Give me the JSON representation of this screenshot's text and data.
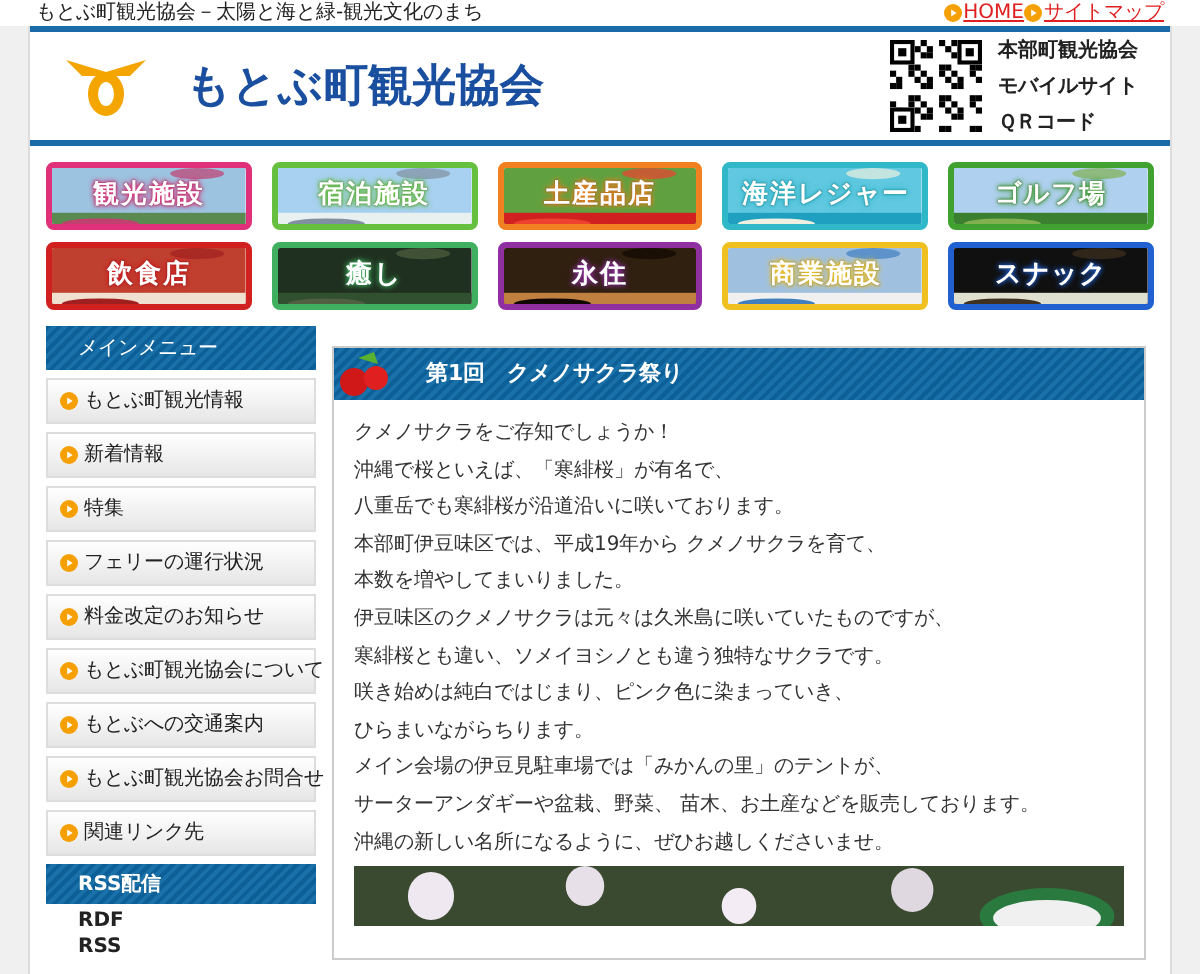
{
  "top_bar": {
    "tagline": "もとぶ町観光協会－太陽と海と緑-観光文化のまち",
    "links": [
      {
        "label": "HOME"
      },
      {
        "label": "サイトマップ"
      }
    ]
  },
  "header": {
    "title": "もとぶ町観光協会",
    "qr_caption": [
      "本部町観光協会",
      "モバイルサイト",
      "ＱＲコード"
    ]
  },
  "banners": [
    {
      "label": "観光施設",
      "color": "#e0307a"
    },
    {
      "label": "宿泊施設",
      "color": "#66c040"
    },
    {
      "label": "土産品店",
      "color": "#f08020"
    },
    {
      "label": "海洋レジャー",
      "color": "#30b8c8"
    },
    {
      "label": "ゴルフ場",
      "color": "#40a030"
    },
    {
      "label": "飲食店",
      "color": "#d02020"
    },
    {
      "label": "癒し",
      "color": "#40b060"
    },
    {
      "label": "永住",
      "color": "#9030a0"
    },
    {
      "label": "商業施設",
      "color": "#f0c020"
    },
    {
      "label": "スナック",
      "color": "#2060d0"
    }
  ],
  "sidebar": {
    "menu_title": "メインメニュー",
    "items": [
      {
        "label": "もとぶ町観光情報"
      },
      {
        "label": "新着情報"
      },
      {
        "label": "特集"
      },
      {
        "label": "フェリーの運行状況"
      },
      {
        "label": "料金改定のお知らせ"
      },
      {
        "label": "もとぶ町観光協会について"
      },
      {
        "label": "もとぶへの交通案内"
      },
      {
        "label": "もとぶ町観光協会お問合せ"
      },
      {
        "label": "関連リンク先"
      }
    ],
    "rss_title": "RSS配信",
    "rss_links": [
      "RDF",
      "RSS"
    ]
  },
  "article": {
    "title": "第1回　クメノサクラ祭り",
    "paragraphs": [
      "クメノサクラをご存知でしょうか！",
      "沖縄で桜といえば、「寒緋桜」が有名で、",
      "八重岳でも寒緋桜が沿道沿いに咲いております。",
      "本部町伊豆味区では、平成19年から クメノサクラを育て、",
      "本数を増やしてまいりました。",
      "伊豆味区のクメノサクラは元々は久米島に咲いていたものですが、",
      "寒緋桜とも違い、ソメイヨシノとも違う独特なサクラです。",
      "咲き始めは純白ではじまり、ピンク色に染まっていき、",
      "ひらまいながらちります。",
      "メイン会場の伊豆見駐車場では「みかんの里」のテントが、",
      "サーターアンダギーや盆栽、野菜、 苗木、お土産などを販売しております。",
      "沖縄の新しい名所になるように、ぜひお越しくださいませ。"
    ]
  }
}
